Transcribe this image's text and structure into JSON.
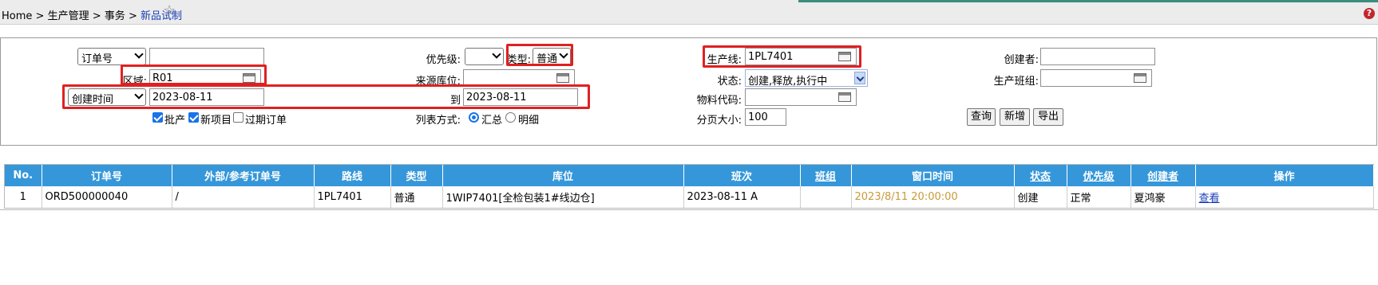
{
  "breadcrumb": {
    "home": "Home",
    "sep1": ">",
    "level1": "生产管理",
    "sep2": ">",
    "level2": "事务",
    "sep3": ">",
    "current": "新品试制"
  },
  "filters": {
    "order_type_select": "订单号",
    "order_no_value": "",
    "priority_label": "优先级:",
    "priority_value": "",
    "type_label": "类型:",
    "type_value": "普通",
    "line_label": "生产线:",
    "line_value": "1PL7401",
    "creator_label": "创建者:",
    "creator_value": "",
    "area_label": "区域:",
    "area_value": "R01",
    "source_loc_label": "来源库位:",
    "source_loc_value": "",
    "status_label": "状态:",
    "status_value": "创建,释放,执行中",
    "team_label": "生产班组:",
    "team_value": "",
    "date_field_select": "创建时间",
    "date_from": "2023-08-11",
    "to_label": "到",
    "date_to": "2023-08-11",
    "material_label": "物料代码:",
    "material_value": "",
    "cb_mass": {
      "label": "批产",
      "checked": true
    },
    "cb_new": {
      "label": "新项目",
      "checked": true
    },
    "cb_overdue": {
      "label": "过期订单",
      "checked": false
    },
    "list_mode_label": "列表方式:",
    "radio_summary": {
      "label": "汇总",
      "checked": true
    },
    "radio_detail": {
      "label": "明细",
      "checked": false
    },
    "page_size_label": "分页大小:",
    "page_size_value": "100"
  },
  "buttons": {
    "query": "查询",
    "add": "新增",
    "export": "导出"
  },
  "table": {
    "headers": [
      "No.",
      "订单号",
      "外部/参考订单号",
      "路线",
      "类型",
      "库位",
      "班次",
      "班组",
      "窗口时间",
      "状态",
      "优先级",
      "创建者",
      "操作"
    ],
    "rows": [
      [
        "1",
        "ORD500000040",
        "/",
        "1PL7401",
        "普通",
        "1WIP7401[全检包装1#线边仓]",
        "2023-08-11 A",
        "",
        "2023/8/11 20:00:00",
        "创建",
        "正常",
        "夏鸿豪",
        "查看"
      ]
    ]
  },
  "colors": {
    "header_bg": "#3597d9",
    "highlight": "#e02020",
    "window_time": "#c79a3a"
  }
}
